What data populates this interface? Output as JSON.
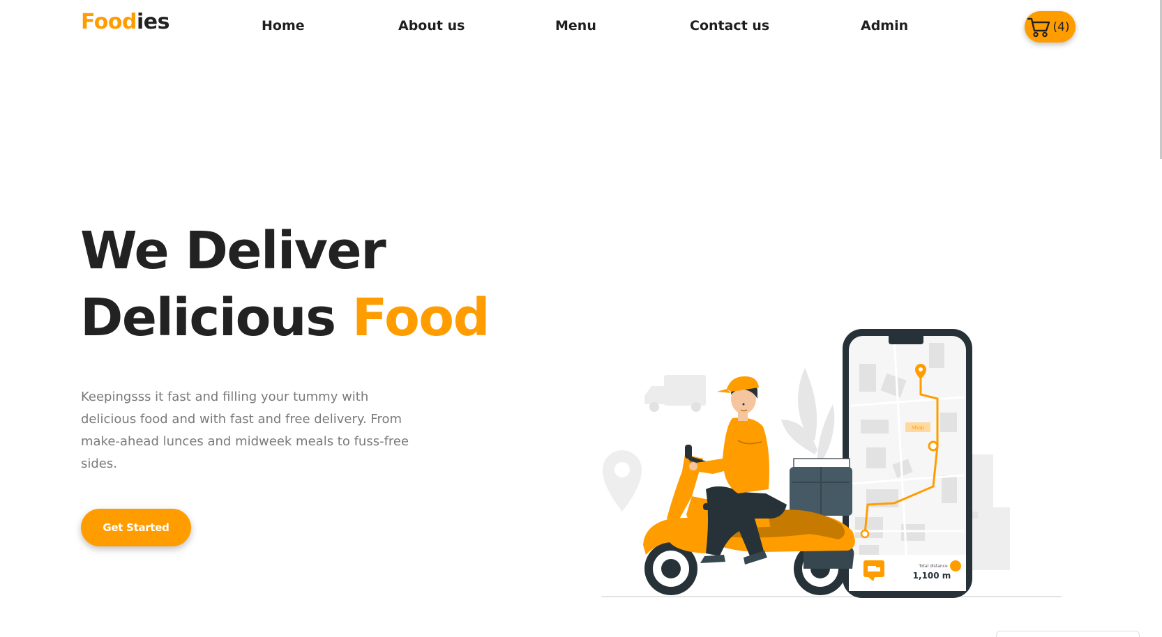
{
  "brand": {
    "logo_part1": "Food",
    "logo_part2": "ies"
  },
  "nav": {
    "links": [
      {
        "label": "Home"
      },
      {
        "label": "About us"
      },
      {
        "label": "Menu"
      },
      {
        "label": "Contact us"
      },
      {
        "label": "Admin"
      }
    ],
    "cart_count": "(4)",
    "cart_icon": "cart-icon"
  },
  "hero": {
    "title_line1": "We Deliver",
    "title_line2_part1": "Delicious ",
    "title_line2_accent": "Food",
    "description": "Keepingsss it fast and filling your tummy with delicious food and with fast and free delivery. From make-ahead lunces and midweek meals to fuss-free sides.",
    "cta_label": "Get Started"
  },
  "illustration": {
    "distance_label": "Total distance",
    "distance_value": "1,100 m",
    "map_tag": "Shop"
  },
  "colors": {
    "accent": "#ff9d00",
    "text_dark": "#222222",
    "text_muted": "#7a7a7a",
    "phone_dark": "#263238"
  }
}
